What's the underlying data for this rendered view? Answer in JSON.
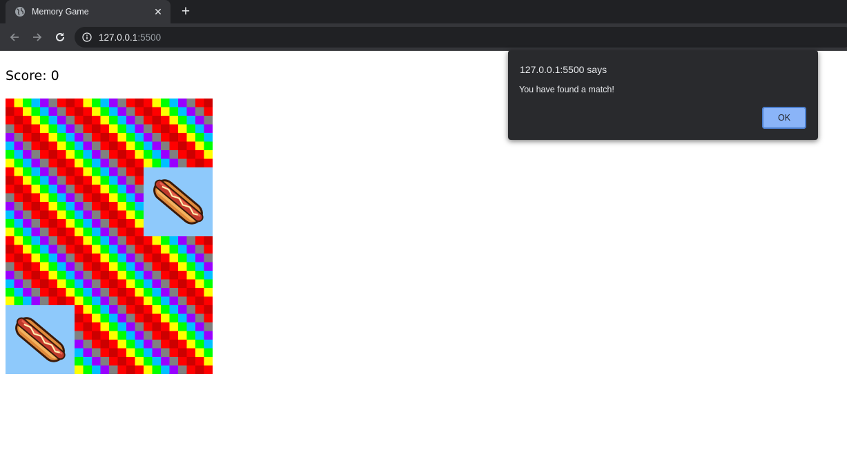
{
  "browser": {
    "tab_title": "Memory Game",
    "url_host": "127.0.0.1",
    "url_port": ":5500",
    "icons": {
      "globe": "globe-icon",
      "close": "close-icon",
      "new_tab": "plus-icon",
      "back": "back-arrow-icon",
      "forward": "forward-arrow-icon",
      "reload": "reload-icon",
      "info": "info-icon"
    }
  },
  "game": {
    "score_text": "Score: 0",
    "cards": [
      {
        "state": "down"
      },
      {
        "state": "down"
      },
      {
        "state": "down"
      },
      {
        "state": "down"
      },
      {
        "state": "down"
      },
      {
        "state": "up",
        "image": "hotdog-icon"
      },
      {
        "state": "down"
      },
      {
        "state": "down"
      },
      {
        "state": "down"
      },
      {
        "state": "up",
        "image": "hotdog-icon"
      },
      {
        "state": "down"
      },
      {
        "state": "down"
      }
    ],
    "card_back_palette": [
      "#ff0000",
      "#ffff00",
      "#00ff00",
      "#00c0ff",
      "#9900ff",
      "#808080",
      "#ff0044",
      "#cc0000"
    ]
  },
  "dialog": {
    "heading": "127.0.0.1:5500 says",
    "message": "You have found a match!",
    "ok_label": "OK"
  }
}
